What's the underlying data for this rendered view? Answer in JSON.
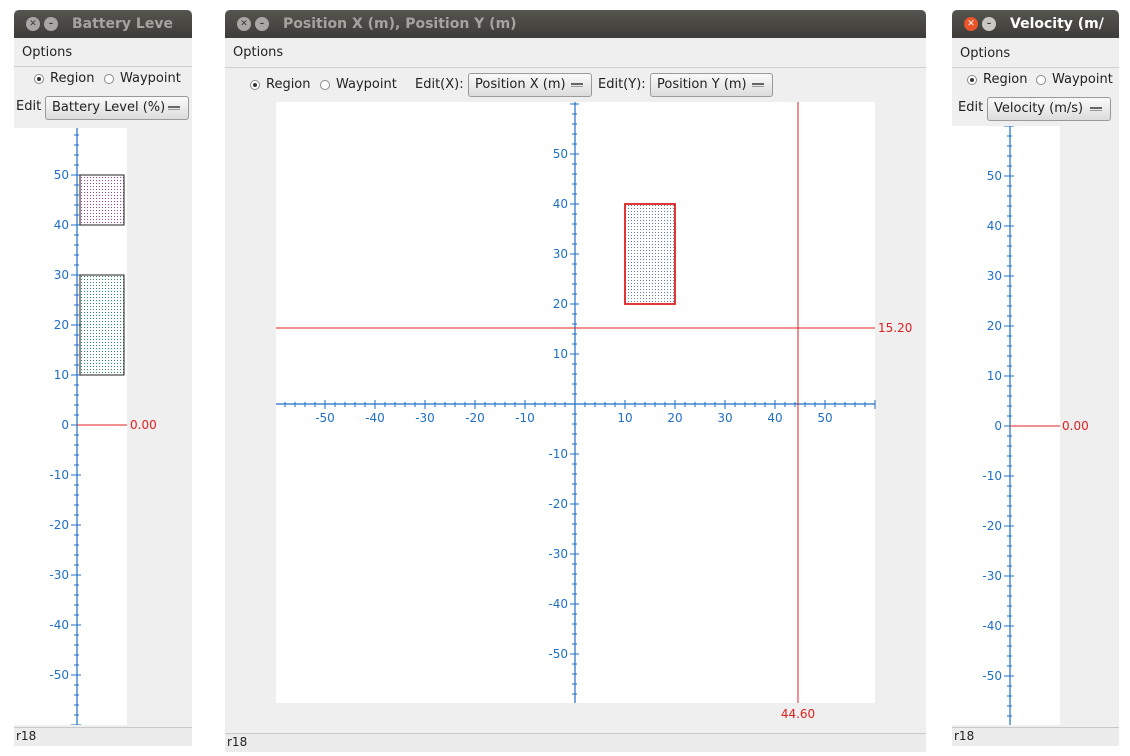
{
  "battery_window": {
    "title": "Battery Leve",
    "menu": "Options",
    "radio_region": "Region",
    "radio_waypoint": "Waypoint",
    "edit_label": "Edit",
    "edit_value": "Battery Level (%)",
    "status": "r18",
    "cursor_value": "0.00"
  },
  "position_window": {
    "title": "Position X (m), Position Y (m)",
    "menu": "Options",
    "radio_region": "Region",
    "radio_waypoint": "Waypoint",
    "edit_x_label": "Edit(X):",
    "edit_x_value": "Position X (m)",
    "edit_y_label": "Edit(Y):",
    "edit_y_value": "Position Y (m)",
    "status": "r18",
    "cursor_x_value": "44.60",
    "cursor_y_value": "15.20"
  },
  "velocity_window": {
    "title": "Velocity (m/",
    "menu": "Options",
    "radio_region": "Region",
    "radio_waypoint": "Waypoint",
    "edit_label": "Edit",
    "edit_value": "Velocity (m/s)",
    "status": "r18",
    "cursor_value": "0.00"
  },
  "colors": {
    "axis": "#1f6fc7",
    "cursor": "#e02020",
    "region_red": "#e02020"
  },
  "chart_data": [
    {
      "type": "region-editor-1d",
      "variable": "Battery Level (%)",
      "ylim": [
        -60,
        60
      ],
      "ticks": [
        -50,
        -40,
        -30,
        -20,
        -10,
        0,
        10,
        20,
        30,
        40,
        50
      ],
      "cursor": 0.0,
      "regions": [
        {
          "min": 10,
          "max": 30,
          "color": "#2a8a6a"
        },
        {
          "min": 40,
          "max": 50,
          "color": "#a040a0"
        }
      ]
    },
    {
      "type": "region-editor-2d",
      "x_variable": "Position X (m)",
      "y_variable": "Position Y (m)",
      "xlim": [
        -60,
        60
      ],
      "ylim": [
        -60,
        60
      ],
      "x_ticks": [
        -50,
        -40,
        -30,
        -20,
        -10,
        10,
        20,
        30,
        40,
        50
      ],
      "y_ticks": [
        -50,
        -40,
        -30,
        -20,
        -10,
        10,
        20,
        30,
        40,
        50
      ],
      "cursor": {
        "x": 44.6,
        "y": 15.2
      },
      "regions": [
        {
          "x": [
            10,
            20
          ],
          "y": [
            20,
            40
          ],
          "color": "#e02020"
        }
      ]
    },
    {
      "type": "region-editor-1d",
      "variable": "Velocity (m/s)",
      "ylim": [
        -60,
        60
      ],
      "ticks": [
        -50,
        -40,
        -30,
        -20,
        -10,
        0,
        10,
        20,
        30,
        40,
        50
      ],
      "cursor": 0.0,
      "regions": []
    }
  ]
}
